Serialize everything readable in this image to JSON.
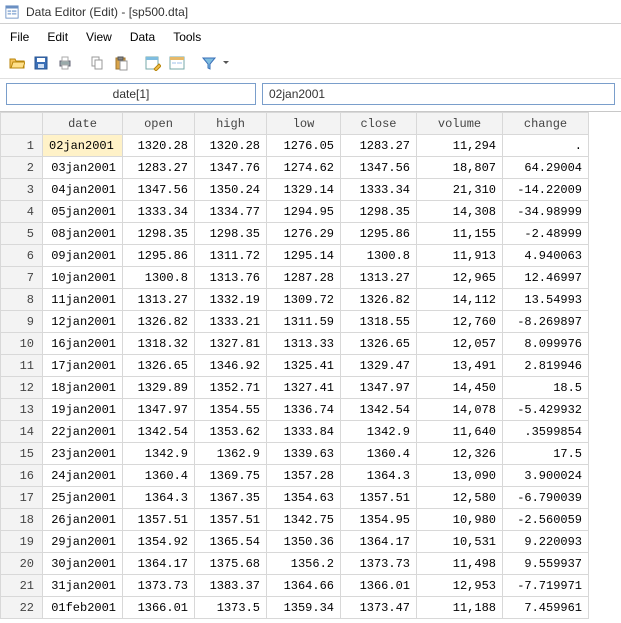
{
  "window": {
    "title": "Data Editor (Edit) - [sp500.dta]"
  },
  "menu": {
    "file": "File",
    "edit": "Edit",
    "view": "View",
    "data": "Data",
    "tools": "Tools"
  },
  "refbar": {
    "cellref": "date[1]",
    "cellval": "02jan2001"
  },
  "columns": {
    "date": "date",
    "open": "open",
    "high": "high",
    "low": "low",
    "close": "close",
    "volume": "volume",
    "change": "change"
  },
  "rows": [
    {
      "n": "1",
      "date": "02jan2001",
      "open": "1320.28",
      "high": "1320.28",
      "low": "1276.05",
      "close": "1283.27",
      "volume": "11,294",
      "change": "."
    },
    {
      "n": "2",
      "date": "03jan2001",
      "open": "1283.27",
      "high": "1347.76",
      "low": "1274.62",
      "close": "1347.56",
      "volume": "18,807",
      "change": "64.29004"
    },
    {
      "n": "3",
      "date": "04jan2001",
      "open": "1347.56",
      "high": "1350.24",
      "low": "1329.14",
      "close": "1333.34",
      "volume": "21,310",
      "change": "-14.22009"
    },
    {
      "n": "4",
      "date": "05jan2001",
      "open": "1333.34",
      "high": "1334.77",
      "low": "1294.95",
      "close": "1298.35",
      "volume": "14,308",
      "change": "-34.98999"
    },
    {
      "n": "5",
      "date": "08jan2001",
      "open": "1298.35",
      "high": "1298.35",
      "low": "1276.29",
      "close": "1295.86",
      "volume": "11,155",
      "change": "-2.48999"
    },
    {
      "n": "6",
      "date": "09jan2001",
      "open": "1295.86",
      "high": "1311.72",
      "low": "1295.14",
      "close": "1300.8",
      "volume": "11,913",
      "change": "4.940063"
    },
    {
      "n": "7",
      "date": "10jan2001",
      "open": "1300.8",
      "high": "1313.76",
      "low": "1287.28",
      "close": "1313.27",
      "volume": "12,965",
      "change": "12.46997"
    },
    {
      "n": "8",
      "date": "11jan2001",
      "open": "1313.27",
      "high": "1332.19",
      "low": "1309.72",
      "close": "1326.82",
      "volume": "14,112",
      "change": "13.54993"
    },
    {
      "n": "9",
      "date": "12jan2001",
      "open": "1326.82",
      "high": "1333.21",
      "low": "1311.59",
      "close": "1318.55",
      "volume": "12,760",
      "change": "-8.269897"
    },
    {
      "n": "10",
      "date": "16jan2001",
      "open": "1318.32",
      "high": "1327.81",
      "low": "1313.33",
      "close": "1326.65",
      "volume": "12,057",
      "change": "8.099976"
    },
    {
      "n": "11",
      "date": "17jan2001",
      "open": "1326.65",
      "high": "1346.92",
      "low": "1325.41",
      "close": "1329.47",
      "volume": "13,491",
      "change": "2.819946"
    },
    {
      "n": "12",
      "date": "18jan2001",
      "open": "1329.89",
      "high": "1352.71",
      "low": "1327.41",
      "close": "1347.97",
      "volume": "14,450",
      "change": "18.5"
    },
    {
      "n": "13",
      "date": "19jan2001",
      "open": "1347.97",
      "high": "1354.55",
      "low": "1336.74",
      "close": "1342.54",
      "volume": "14,078",
      "change": "-5.429932"
    },
    {
      "n": "14",
      "date": "22jan2001",
      "open": "1342.54",
      "high": "1353.62",
      "low": "1333.84",
      "close": "1342.9",
      "volume": "11,640",
      "change": ".3599854"
    },
    {
      "n": "15",
      "date": "23jan2001",
      "open": "1342.9",
      "high": "1362.9",
      "low": "1339.63",
      "close": "1360.4",
      "volume": "12,326",
      "change": "17.5"
    },
    {
      "n": "16",
      "date": "24jan2001",
      "open": "1360.4",
      "high": "1369.75",
      "low": "1357.28",
      "close": "1364.3",
      "volume": "13,090",
      "change": "3.900024"
    },
    {
      "n": "17",
      "date": "25jan2001",
      "open": "1364.3",
      "high": "1367.35",
      "low": "1354.63",
      "close": "1357.51",
      "volume": "12,580",
      "change": "-6.790039"
    },
    {
      "n": "18",
      "date": "26jan2001",
      "open": "1357.51",
      "high": "1357.51",
      "low": "1342.75",
      "close": "1354.95",
      "volume": "10,980",
      "change": "-2.560059"
    },
    {
      "n": "19",
      "date": "29jan2001",
      "open": "1354.92",
      "high": "1365.54",
      "low": "1350.36",
      "close": "1364.17",
      "volume": "10,531",
      "change": "9.220093"
    },
    {
      "n": "20",
      "date": "30jan2001",
      "open": "1364.17",
      "high": "1375.68",
      "low": "1356.2",
      "close": "1373.73",
      "volume": "11,498",
      "change": "9.559937"
    },
    {
      "n": "21",
      "date": "31jan2001",
      "open": "1373.73",
      "high": "1383.37",
      "low": "1364.66",
      "close": "1366.01",
      "volume": "12,953",
      "change": "-7.719971"
    },
    {
      "n": "22",
      "date": "01feb2001",
      "open": "1366.01",
      "high": "1373.5",
      "low": "1359.34",
      "close": "1373.47",
      "volume": "11,188",
      "change": "7.459961"
    }
  ]
}
